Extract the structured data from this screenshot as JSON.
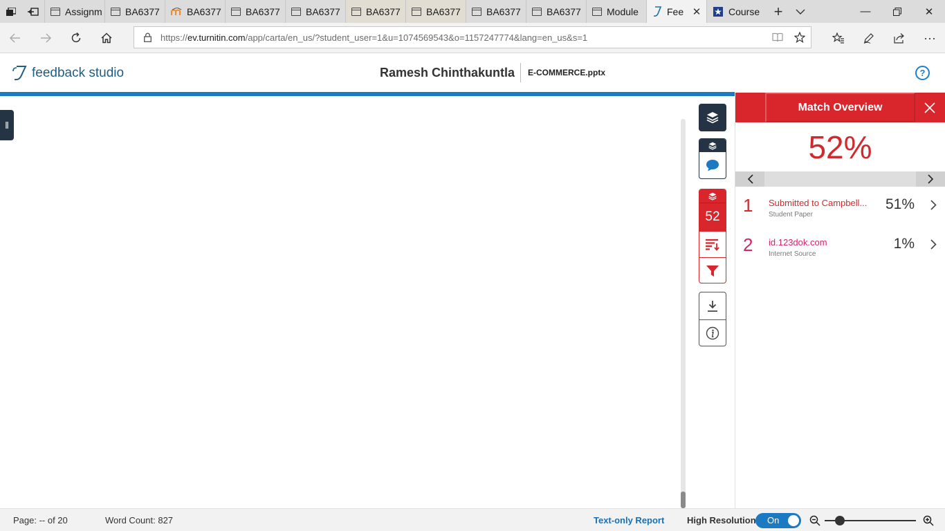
{
  "tabs": [
    {
      "label": "Assignm",
      "icon": "page-icon",
      "state": "normal"
    },
    {
      "label": "BA6377",
      "icon": "page-icon",
      "state": "normal"
    },
    {
      "label": "BA6377",
      "icon": "moodle-icon",
      "state": "normal"
    },
    {
      "label": "BA6377",
      "icon": "page-icon",
      "state": "normal"
    },
    {
      "label": "BA6377",
      "icon": "page-icon",
      "state": "normal"
    },
    {
      "label": "BA6377",
      "icon": "page-icon",
      "state": "tinted"
    },
    {
      "label": "BA6377",
      "icon": "page-icon",
      "state": "tinted"
    },
    {
      "label": "BA6377",
      "icon": "page-icon",
      "state": "normal"
    },
    {
      "label": "BA6377",
      "icon": "page-icon",
      "state": "normal"
    },
    {
      "label": "Module",
      "icon": "page-icon",
      "state": "normal"
    },
    {
      "label": "Fee",
      "icon": "turnitin-icon",
      "state": "active"
    },
    {
      "label": "Course",
      "icon": "star-badge-icon",
      "state": "normal"
    }
  ],
  "address": {
    "url_prefix": "https://",
    "url_host": "ev.turnitin.com",
    "url_path": "/app/carta/en_us/?student_user=1&u=1074569543&o=1157247774&lang=en_us&s=1"
  },
  "header": {
    "brand": "feedback studio",
    "student_name": "Ramesh Chinthakuntla",
    "file_name": "E-COMMERCE.pptx",
    "help_label": "?"
  },
  "toolbar": {
    "similarity_score": "52"
  },
  "panel": {
    "title": "Match Overview",
    "overall_percent": "52%",
    "matches": [
      {
        "rank": "1",
        "source": "Submitted to Campbell...",
        "type": "Student Paper",
        "percent": "51%",
        "color": "#d02a2f"
      },
      {
        "rank": "2",
        "source": "id.123dok.com",
        "type": "Internet Source",
        "percent": "1%",
        "color": "#d4246b"
      }
    ]
  },
  "status": {
    "page": "Page: -- of 20",
    "word_count": "Word Count: 827",
    "text_only": "Text-only Report",
    "high_res_label": "High Resolution",
    "toggle_state": "On"
  },
  "colors": {
    "accent_red": "#d8262c",
    "accent_blue": "#1b7ac1",
    "navy": "#243444"
  }
}
